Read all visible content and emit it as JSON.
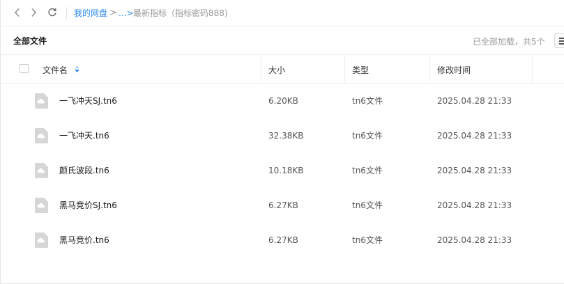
{
  "nav": {
    "back_icon": "chevron-left-icon",
    "forward_icon": "chevron-right-icon",
    "refresh_icon": "refresh-icon"
  },
  "breadcrumb": {
    "root": "我的网盘",
    "separator": ">",
    "ellipsis": "...>",
    "current": "最新指标（指标密码888)"
  },
  "header": {
    "title": "全部文件",
    "status": "已全部加载，共5个"
  },
  "columns": {
    "name": "文件名",
    "size": "大小",
    "type": "类型",
    "modified": "修改时间"
  },
  "files": [
    {
      "name": "一飞冲天SJ.tn6",
      "size": "6.20KB",
      "type": "tn6文件",
      "modified": "2025.04.28 21:33"
    },
    {
      "name": "一飞冲天.tn6",
      "size": "32.38KB",
      "type": "tn6文件",
      "modified": "2025.04.28 21:33"
    },
    {
      "name": "颜氏波段.tn6",
      "size": "10.18KB",
      "type": "tn6文件",
      "modified": "2025.04.28 21:33"
    },
    {
      "name": "黑马竞价SJ.tn6",
      "size": "6.27KB",
      "type": "tn6文件",
      "modified": "2025.04.28 21:33"
    },
    {
      "name": "黑马竞价.tn6",
      "size": "6.27KB",
      "type": "tn6文件",
      "modified": "2025.04.28 21:33"
    }
  ],
  "colors": {
    "accent": "#2e8cf0",
    "muted": "#999999",
    "icon_gray": "#d6d6d6"
  }
}
